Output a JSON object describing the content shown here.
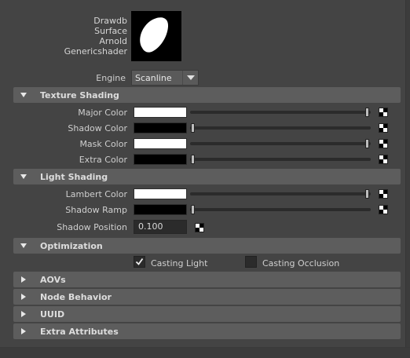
{
  "shader": {
    "names": [
      "Drawdb",
      "Surface",
      "Arnold",
      "Genericshader"
    ]
  },
  "engine": {
    "label": "Engine",
    "value": "Scanline"
  },
  "sections": {
    "texture_shading": "Texture Shading",
    "light_shading": "Light Shading",
    "optimization": "Optimization",
    "aovs": "AOVs",
    "node_behavior": "Node Behavior",
    "uuid": "UUID",
    "extra_attributes": "Extra Attributes"
  },
  "texture_shading": {
    "major_color": {
      "label": "Major Color",
      "color": "#ffffff",
      "level": 1.0
    },
    "shadow_color": {
      "label": "Shadow Color",
      "color": "#000000",
      "level": 0.0
    },
    "mask_color": {
      "label": "Mask Color",
      "color": "#ffffff",
      "level": 1.0
    },
    "extra_color": {
      "label": "Extra Color",
      "color": "#000000",
      "level": 0.0
    }
  },
  "light_shading": {
    "lambert_color": {
      "label": "Lambert Color",
      "color": "#ffffff",
      "level": 1.0
    },
    "shadow_ramp": {
      "label": "Shadow Ramp",
      "color": "#000000",
      "level": 0.0
    },
    "shadow_position": {
      "label": "Shadow Position",
      "value": "0.100"
    }
  },
  "optimization": {
    "casting_light": {
      "label": "Casting Light",
      "checked": true
    },
    "casting_occlusion": {
      "label": "Casting Occlusion",
      "checked": false
    }
  },
  "colors": {
    "background": "#444444",
    "section_header": "#5d5d5d"
  },
  "icons": {
    "map_button": "checker-map-icon",
    "section_open": "triangle-down-icon",
    "section_closed": "triangle-right-icon"
  }
}
